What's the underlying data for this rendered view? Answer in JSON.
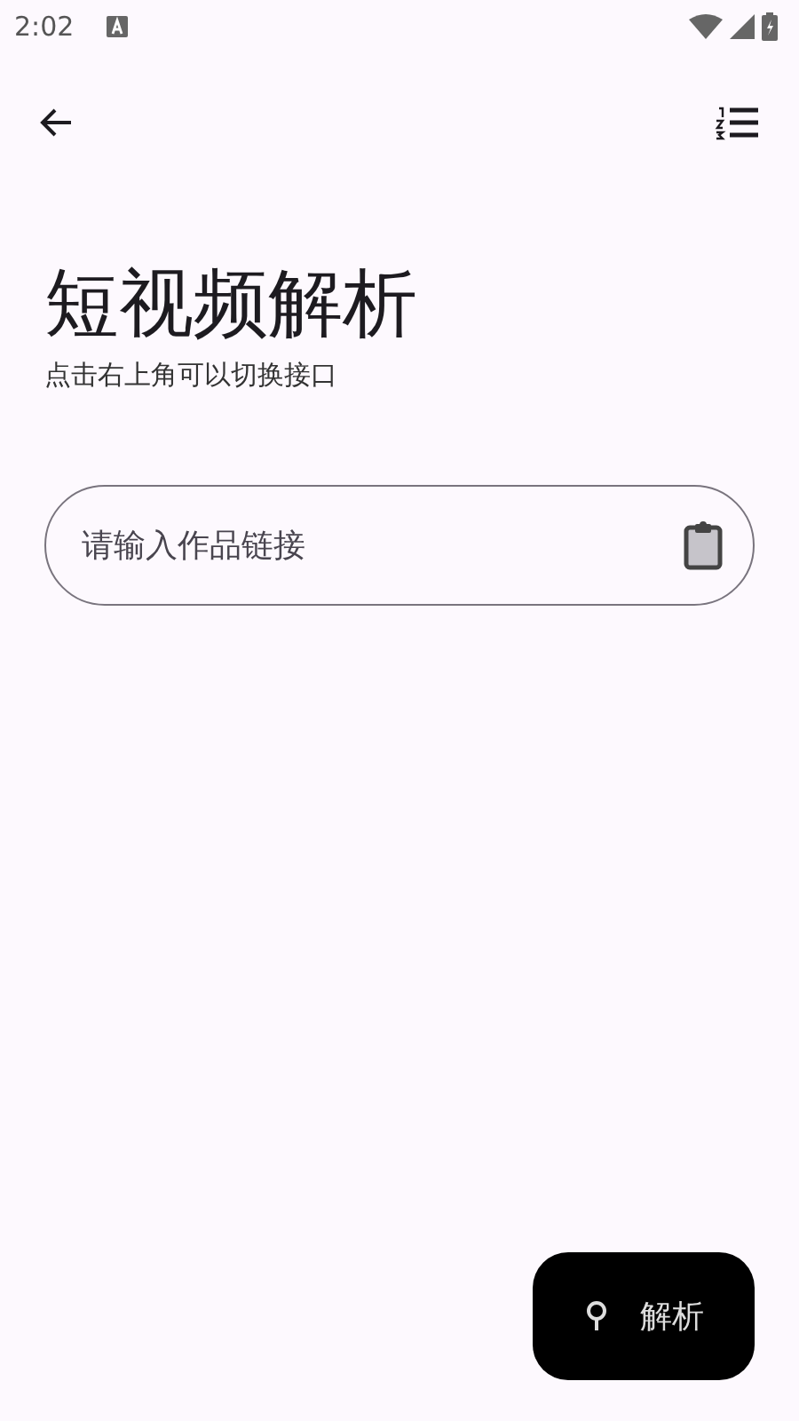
{
  "status_bar": {
    "time": "2:02"
  },
  "title": "短视频解析",
  "subtitle": "点击右上角可以切换接口",
  "link_field": {
    "placeholder": "请输入作品链接"
  },
  "fab": {
    "label": "解析"
  }
}
